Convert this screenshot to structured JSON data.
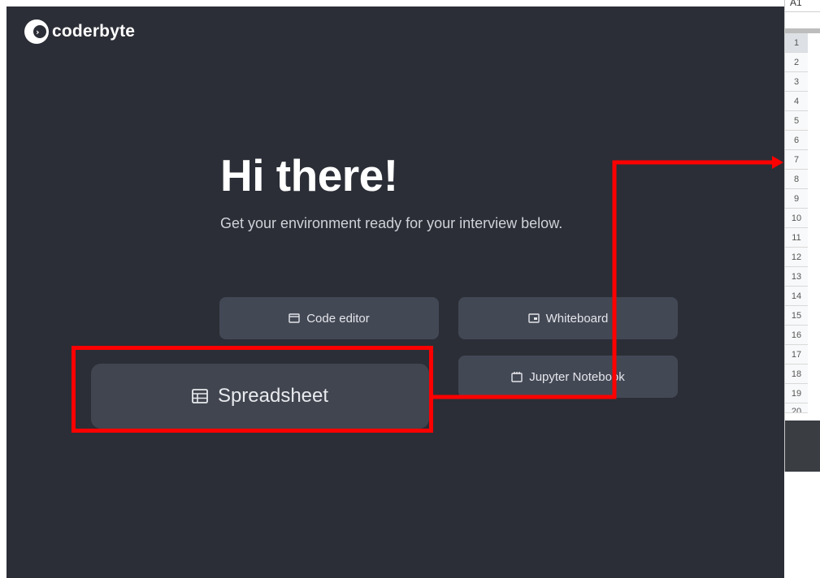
{
  "brand": {
    "name": "coderbyte"
  },
  "hero": {
    "title": "Hi there!",
    "subtitle": "Get your environment ready for your interview below."
  },
  "buttons": {
    "code_editor": "Code editor",
    "whiteboard": "Whiteboard",
    "jupyter": "Jupyter Notebook",
    "spreadsheet": "Spreadsheet"
  },
  "sheet": {
    "cell_ref": "A1",
    "rows": [
      "1",
      "2",
      "3",
      "4",
      "5",
      "6",
      "7",
      "8",
      "9",
      "10",
      "11",
      "12",
      "13",
      "14",
      "15",
      "16",
      "17",
      "18",
      "19",
      "20"
    ]
  },
  "colors": {
    "background": "#2b2e36",
    "button": "#434855",
    "highlight": "#ff0000",
    "text": "#ffffff"
  }
}
